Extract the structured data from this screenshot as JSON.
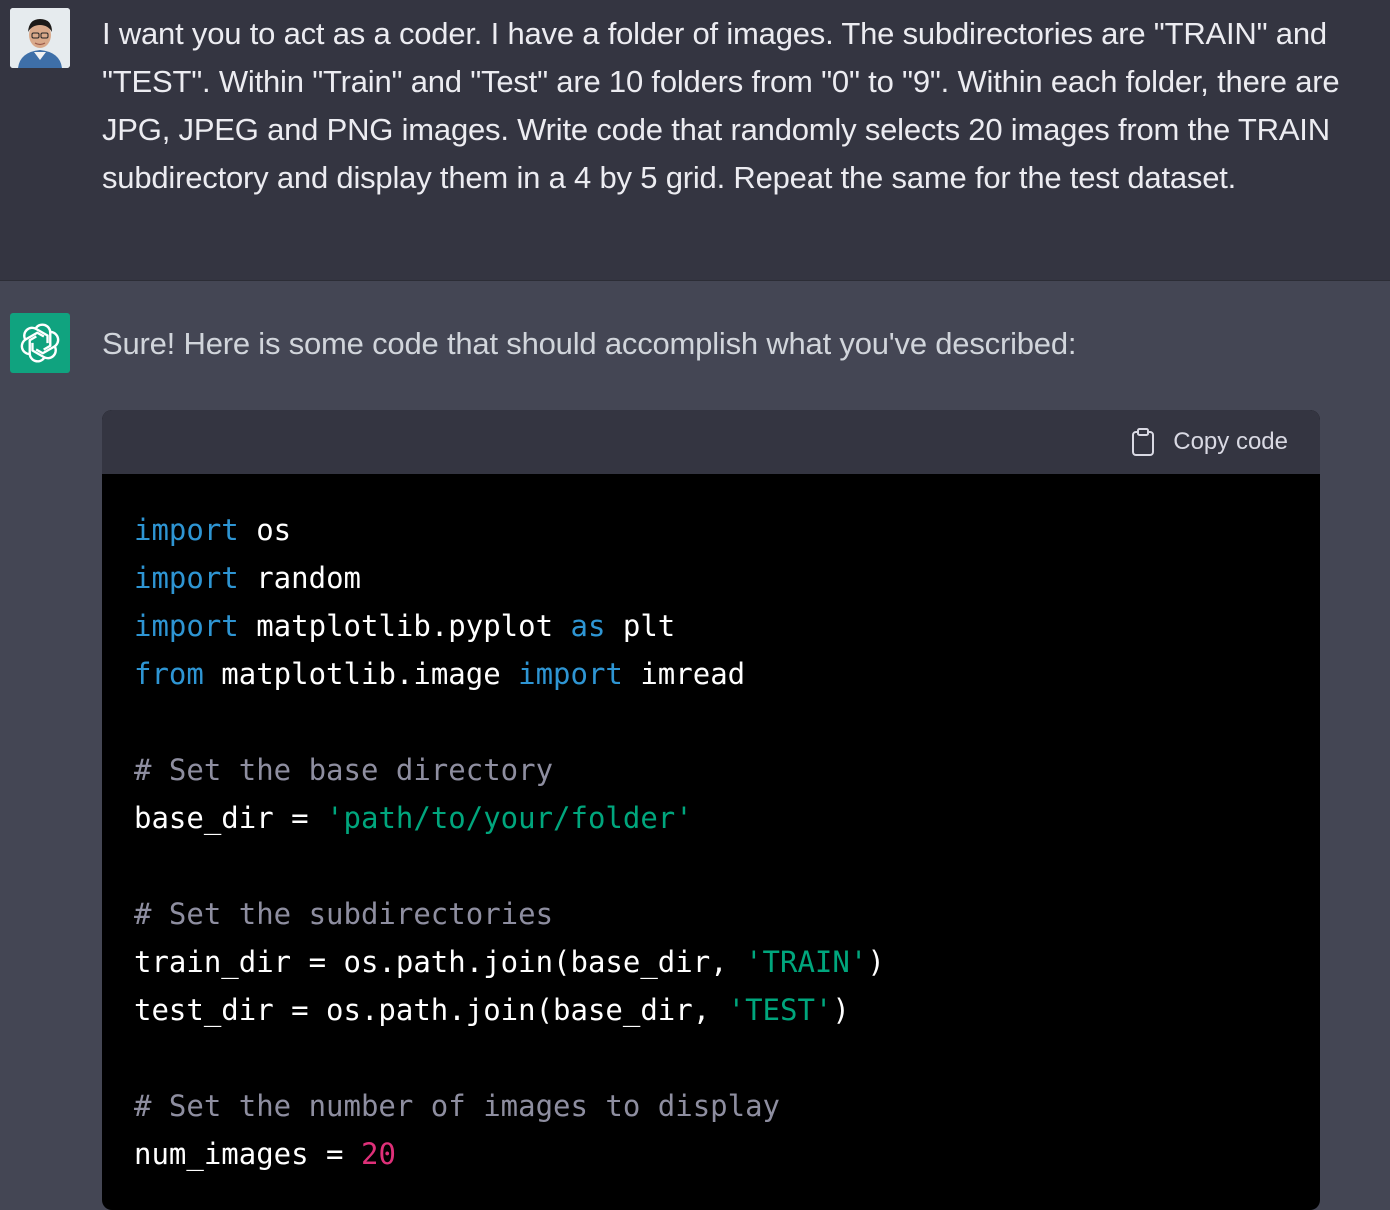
{
  "user_message": {
    "text": "I want you to act as a coder. I have a folder of images. The subdirectories are \"TRAIN\" and \"TEST\". Within \"Train\" and \"Test\" are 10 folders from \"0\" to \"9\". Within each folder, there are JPG, JPEG and PNG images. Write code that randomly selects 20 images from the TRAIN subdirectory and display them in a 4 by 5 grid. Repeat the same for the test dataset."
  },
  "assistant_message": {
    "intro": "Sure! Here is some code that should accomplish what you've described:",
    "copy_label": "Copy code"
  },
  "code_lines": [
    [
      {
        "t": "import",
        "c": "kw"
      },
      {
        "t": " os",
        "c": "plain"
      }
    ],
    [
      {
        "t": "import",
        "c": "kw"
      },
      {
        "t": " random",
        "c": "plain"
      }
    ],
    [
      {
        "t": "import",
        "c": "kw"
      },
      {
        "t": " matplotlib.pyplot ",
        "c": "plain"
      },
      {
        "t": "as",
        "c": "kw"
      },
      {
        "t": " plt",
        "c": "plain"
      }
    ],
    [
      {
        "t": "from",
        "c": "kw"
      },
      {
        "t": " matplotlib.image ",
        "c": "plain"
      },
      {
        "t": "import",
        "c": "kw"
      },
      {
        "t": " imread",
        "c": "plain"
      }
    ],
    [],
    [
      {
        "t": "# Set the base directory",
        "c": "cm"
      }
    ],
    [
      {
        "t": "base_dir = ",
        "c": "plain"
      },
      {
        "t": "'path/to/your/folder'",
        "c": "str"
      }
    ],
    [],
    [
      {
        "t": "# Set the subdirectories",
        "c": "cm"
      }
    ],
    [
      {
        "t": "train_dir = os.path.join(base_dir, ",
        "c": "plain"
      },
      {
        "t": "'TRAIN'",
        "c": "str"
      },
      {
        "t": ")",
        "c": "plain"
      }
    ],
    [
      {
        "t": "test_dir = os.path.join(base_dir, ",
        "c": "plain"
      },
      {
        "t": "'TEST'",
        "c": "str"
      },
      {
        "t": ")",
        "c": "plain"
      }
    ],
    [],
    [
      {
        "t": "# Set the number of images to display",
        "c": "cm"
      }
    ],
    [
      {
        "t": "num_images = ",
        "c": "plain"
      },
      {
        "t": "20",
        "c": "num"
      }
    ]
  ],
  "colors": {
    "keyword": "#2e95d3",
    "comment": "#8e8ea0",
    "string": "#00a67d",
    "number": "#df3079",
    "brand": "#10a37f"
  },
  "icons": {
    "user_avatar": "user-avatar",
    "assistant_avatar": "openai-logo-icon",
    "copy": "clipboard-icon"
  }
}
